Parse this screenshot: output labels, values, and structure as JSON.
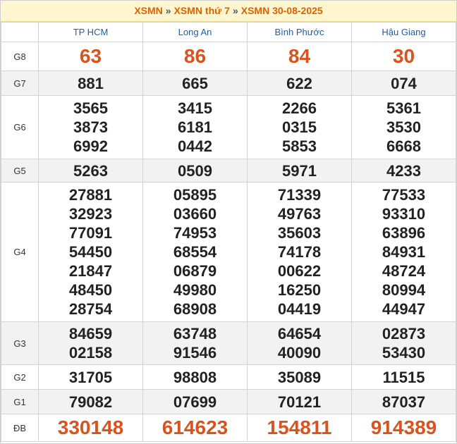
{
  "breadcrumb": {
    "items": [
      "XSMN",
      "XSMN thứ 7",
      "XSMN 30-08-2025"
    ],
    "separator": "»"
  },
  "provinces": [
    "TP HCM",
    "Long An",
    "Bình Phước",
    "Hậu Giang"
  ],
  "rows": [
    {
      "label": "G8",
      "values": [
        [
          "63"
        ],
        [
          "86"
        ],
        [
          "84"
        ],
        [
          "30"
        ]
      ]
    },
    {
      "label": "G7",
      "values": [
        [
          "881"
        ],
        [
          "665"
        ],
        [
          "622"
        ],
        [
          "074"
        ]
      ]
    },
    {
      "label": "G6",
      "values": [
        [
          "3565",
          "3873",
          "6992"
        ],
        [
          "3415",
          "6181",
          "0442"
        ],
        [
          "2266",
          "0315",
          "5853"
        ],
        [
          "5361",
          "3530",
          "6668"
        ]
      ]
    },
    {
      "label": "G5",
      "values": [
        [
          "5263"
        ],
        [
          "0509"
        ],
        [
          "5971"
        ],
        [
          "4233"
        ]
      ]
    },
    {
      "label": "G4",
      "values": [
        [
          "27881",
          "32923",
          "77091",
          "54450",
          "21847",
          "48450",
          "28754"
        ],
        [
          "05895",
          "03660",
          "74953",
          "68554",
          "06879",
          "49980",
          "68908"
        ],
        [
          "71339",
          "49763",
          "35603",
          "74178",
          "00622",
          "16250",
          "04419"
        ],
        [
          "77533",
          "93310",
          "63896",
          "84931",
          "48724",
          "80994",
          "44947"
        ]
      ]
    },
    {
      "label": "G3",
      "values": [
        [
          "84659",
          "02158"
        ],
        [
          "63748",
          "91546"
        ],
        [
          "64654",
          "40090"
        ],
        [
          "02873",
          "53430"
        ]
      ]
    },
    {
      "label": "G2",
      "values": [
        [
          "31705"
        ],
        [
          "98808"
        ],
        [
          "35089"
        ],
        [
          "11515"
        ]
      ]
    },
    {
      "label": "G1",
      "values": [
        [
          "79082"
        ],
        [
          "07699"
        ],
        [
          "70121"
        ],
        [
          "87037"
        ]
      ]
    },
    {
      "label": "ĐB",
      "values": [
        [
          "330148"
        ],
        [
          "614623"
        ],
        [
          "154811"
        ],
        [
          "914389"
        ]
      ]
    }
  ],
  "colors": {
    "accent": "#e06000",
    "header_text": "#1a5ea8",
    "prize_big": "#d9531e",
    "alt_row": "#f2f2f2"
  }
}
